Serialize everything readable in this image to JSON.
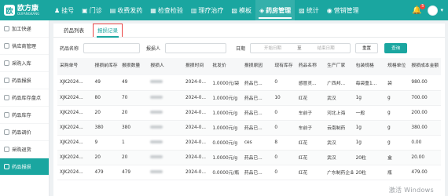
{
  "app": {
    "logo_mark": "欧",
    "logo_name": "欧方康",
    "logo_sub": "OUFANGKANG"
  },
  "nav": {
    "items": [
      {
        "label": "挂号",
        "icon": "register-icon",
        "glyph": "♟"
      },
      {
        "label": "门诊",
        "icon": "clinic-icon",
        "glyph": "▣"
      },
      {
        "label": "收费发药",
        "icon": "billing-icon",
        "glyph": "▤"
      },
      {
        "label": "检查检验",
        "icon": "lab-icon",
        "glyph": "▦"
      },
      {
        "label": "理疗治疗",
        "icon": "therapy-icon",
        "glyph": "▥"
      },
      {
        "label": "模板",
        "icon": "template-icon",
        "glyph": "▧"
      },
      {
        "label": "药房管理",
        "icon": "pharmacy-icon",
        "glyph": "◈"
      },
      {
        "label": "统计",
        "icon": "stats-icon",
        "glyph": "▨"
      },
      {
        "label": "营销管理",
        "icon": "marketing-icon",
        "glyph": "◉"
      }
    ],
    "active_index": 6,
    "notification_count": "5"
  },
  "sidebar": {
    "items": [
      {
        "label": "加工快递"
      },
      {
        "label": "供应商管理"
      },
      {
        "label": "采购入库"
      },
      {
        "label": "药品报损"
      },
      {
        "label": "药品库存盘点"
      },
      {
        "label": "药品库存"
      },
      {
        "label": "药品调价"
      },
      {
        "label": "采购退货"
      },
      {
        "label": "药品报损"
      }
    ],
    "active_index": 8
  },
  "tabs": [
    {
      "label": "药品列表"
    },
    {
      "label": "报损记录"
    }
  ],
  "active_tab": 1,
  "filters": {
    "drug_name_label": "药品名称",
    "reporter_label": "报损人",
    "date_label": "日期",
    "start_placeholder": "开始日期",
    "range_sep": "至",
    "end_placeholder": "结束日期",
    "reset_label": "重置",
    "query_label": "查询"
  },
  "table": {
    "headers": [
      "采购单号",
      "报损前库存",
      "报损数量",
      "报损人",
      "报损时间",
      "批发价",
      "报损原因",
      "现有库存",
      "药品名称",
      "生产厂家",
      "包装规格",
      "规格单位",
      "报损成本金额"
    ],
    "rows": [
      [
        "XJK2024...",
        "49",
        "49",
        "",
        "2024-0...",
        "1.0000元/袋",
        "药品已...",
        "0",
        "感冒灵...",
        "广西邦...",
        "每袋重1...",
        "袋",
        "980.00"
      ],
      [
        "XJK2024...",
        "80",
        "70",
        "",
        "2024-0...",
        "1.0000元/g",
        "药品已...",
        "10",
        "红花",
        "武汉",
        "1g",
        "g",
        "700.00"
      ],
      [
        "XJK2024...",
        "20",
        "20",
        "",
        "2024-0...",
        "1.0000元/g",
        "药品已...",
        "0",
        "车前子",
        "河北上海",
        "一般",
        "g",
        "200.00"
      ],
      [
        "XJK2024...",
        "380",
        "380",
        "",
        "2024-0...",
        "1.0000元/g",
        "药品已...",
        "0",
        "车前子",
        "云南制药",
        "1g",
        "g",
        "380.00"
      ],
      [
        "XJK2024...",
        "9",
        "1",
        "",
        "2024-0...",
        "0.0000元/g",
        "ces",
        "8",
        "红花",
        "武汉",
        "1g",
        "g",
        "0.00"
      ],
      [
        "XJK2024...",
        "20",
        "20",
        "",
        "2024-0...",
        "1.0000元/g",
        "药品已...",
        "0",
        "红花",
        "武汉",
        "20粒",
        "盒",
        "20.00"
      ],
      [
        "XJK2024...",
        "479",
        "479",
        "",
        "2024-0...",
        "0.0000元/瓶",
        "药品已...",
        "0",
        "红花",
        "广东制药企业",
        "20粒",
        "瓶",
        "479.00"
      ]
    ]
  },
  "watermark": "激活 Windows",
  "colors": {
    "accent": "#1aa6a0",
    "highlight_border": "#e94545",
    "badge": "#f0453a"
  }
}
